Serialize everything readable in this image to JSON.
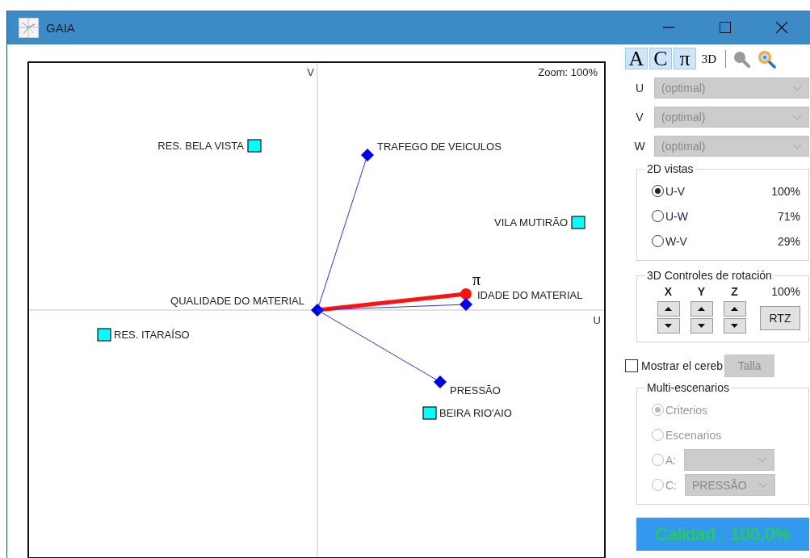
{
  "window": {
    "title": "GAIA"
  },
  "plot": {
    "zoom_label": "Zoom: 100%",
    "axis_u": "U",
    "axis_v": "V",
    "criteria": [
      {
        "label": "TRAFEGO DE VEICULOS"
      },
      {
        "label": "QUALIDADE DO MATERIAL"
      },
      {
        "label": "IDADE DO MATERIAL"
      },
      {
        "label": "PRESSÃO"
      }
    ],
    "decision_axis": {
      "label": "π"
    },
    "alternatives": [
      {
        "label": "RES. BELA VISTA"
      },
      {
        "label": "VILA MUTIRÃO"
      },
      {
        "label": "RES. ITARAÍSO"
      },
      {
        "label": "BEIRA RIO'AIO"
      }
    ]
  },
  "toolbar": [
    {
      "label": "A",
      "selected": true
    },
    {
      "label": "C",
      "selected": true
    },
    {
      "label": "π",
      "selected": true
    },
    {
      "label": "3D",
      "selected": false
    }
  ],
  "axis_selectors": [
    {
      "label": "U",
      "value": "(optimal)",
      "disabled": true
    },
    {
      "label": "V",
      "value": "(optimal)",
      "disabled": true
    },
    {
      "label": "W",
      "value": "(optimal)",
      "disabled": true
    }
  ],
  "views_2d": {
    "title": "2D vistas",
    "options": [
      {
        "label": "U-V",
        "percent": "100%",
        "selected": true
      },
      {
        "label": "U-W",
        "percent": "71%",
        "selected": false
      },
      {
        "label": "W-V",
        "percent": "29%",
        "selected": false
      }
    ]
  },
  "rotation": {
    "title": "3D Controles de rotación",
    "axes": [
      "X",
      "Y",
      "Z"
    ],
    "zoom": "100%",
    "reset_button": "RTZ"
  },
  "show_brain": {
    "label": "Mostrar el cereb",
    "checked": false
  },
  "size_button": {
    "label": "Talla",
    "disabled": true
  },
  "multi_scenarios": {
    "title": "Multi-escenarios",
    "disabled": true,
    "options": [
      {
        "label": "Criterios",
        "selected": true,
        "kind": "plain"
      },
      {
        "label": "Escenarios",
        "selected": false,
        "kind": "plain"
      },
      {
        "label": "A:",
        "selected": false,
        "kind": "select"
      },
      {
        "label": "C:",
        "selected": false,
        "kind": "select",
        "value": "PRESSÃO"
      }
    ]
  },
  "quality": "Calidad : 100,0%"
}
